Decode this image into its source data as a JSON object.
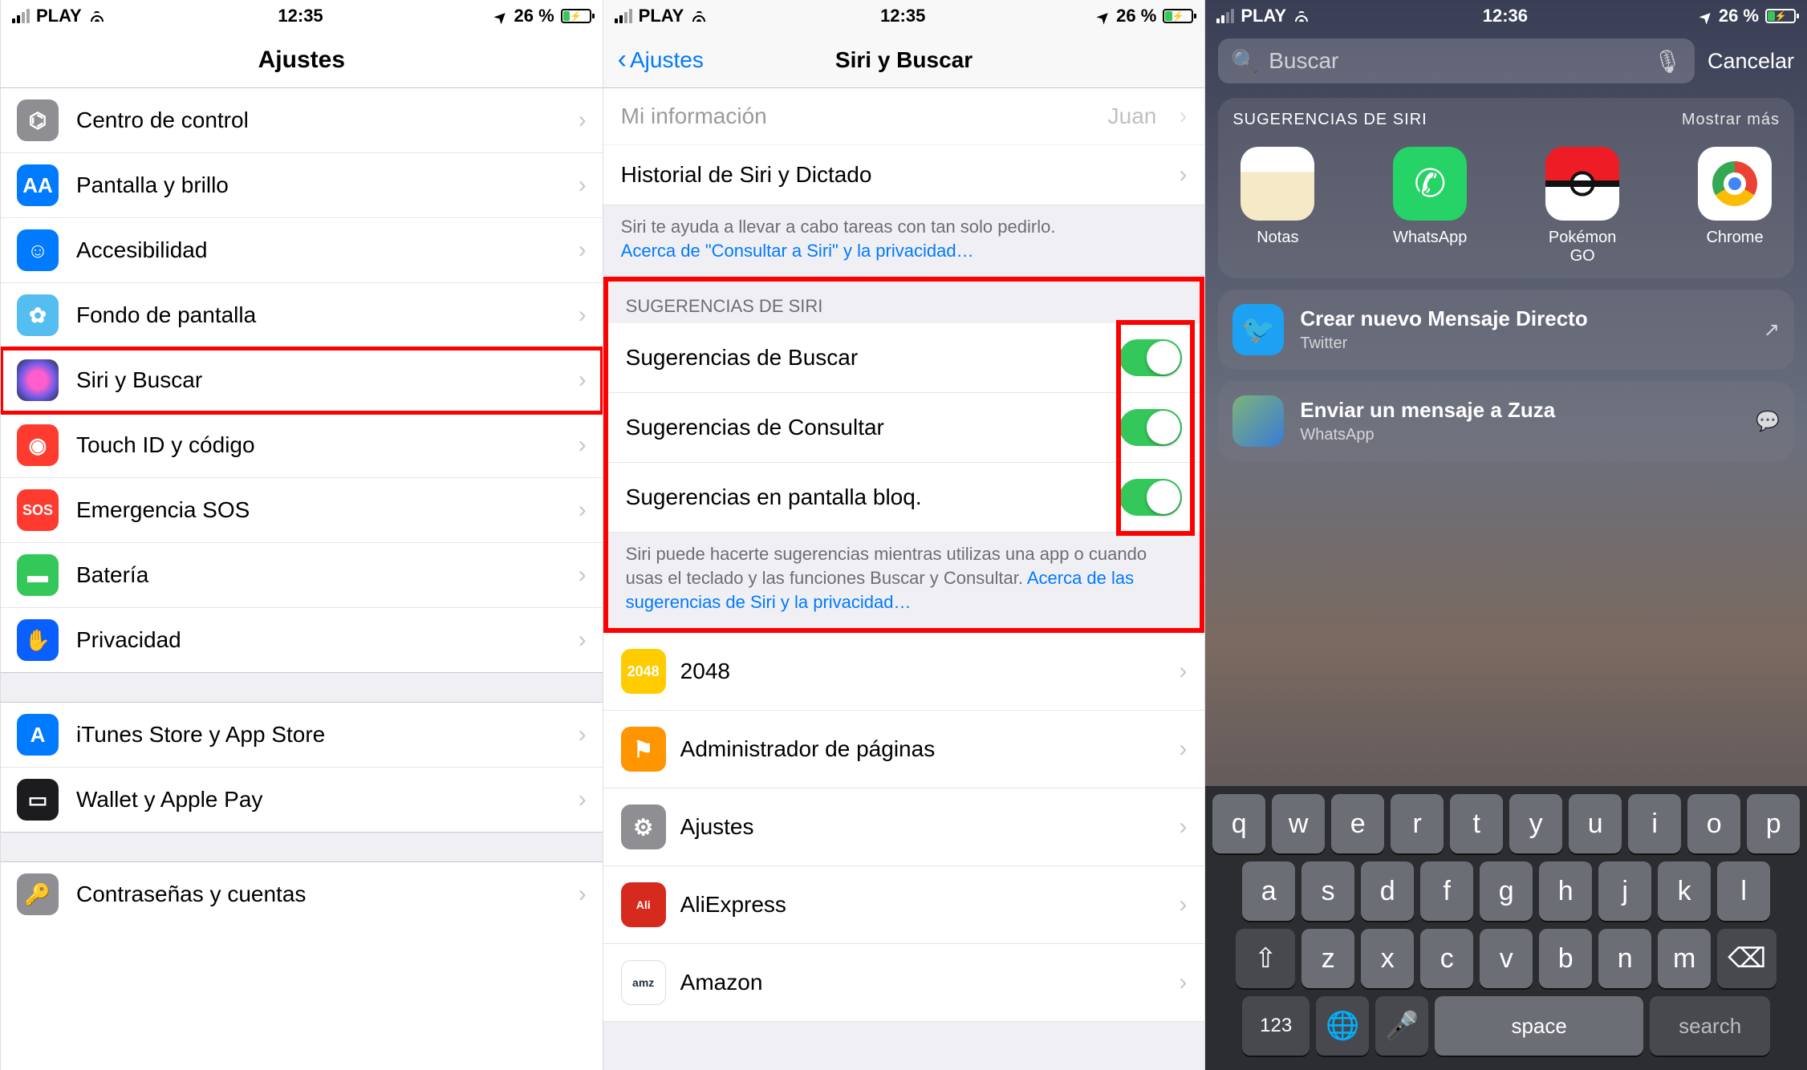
{
  "status": {
    "carrier": "PLAY",
    "time1": "12:35",
    "time2": "12:35",
    "time3": "12:36",
    "battery": "26 %"
  },
  "s1": {
    "title": "Ajustes",
    "rows": [
      {
        "label": "Centro de control"
      },
      {
        "label": "Pantalla y brillo"
      },
      {
        "label": "Accesibilidad"
      },
      {
        "label": "Fondo de pantalla"
      },
      {
        "label": "Siri y Buscar",
        "hl": true
      },
      {
        "label": "Touch ID y código"
      },
      {
        "label": "Emergencia SOS"
      },
      {
        "label": "Batería"
      },
      {
        "label": "Privacidad"
      }
    ],
    "rows2": [
      {
        "label": "iTunes Store y App Store"
      },
      {
        "label": "Wallet y Apple Pay"
      }
    ],
    "rows3": [
      {
        "label": "Contraseñas y cuentas"
      }
    ]
  },
  "s2": {
    "back": "Ajustes",
    "title": "Siri y Buscar",
    "partial": {
      "label": "Mi información",
      "value": "Juan"
    },
    "history": "Historial de Siri y Dictado",
    "foot1_text": "Siri te ayuda a llevar a cabo tareas con tan solo pedirlo.",
    "foot1_link": "Acerca de \"Consultar a Siri\" y la privacidad…",
    "sect": "SUGERENCIAS DE SIRI",
    "toggles": [
      {
        "label": "Sugerencias de Buscar"
      },
      {
        "label": "Sugerencias de Consultar"
      },
      {
        "label": "Sugerencias en pantalla bloq."
      }
    ],
    "foot2_text": "Siri puede hacerte sugerencias mientras utilizas una app o cuando usas el teclado y las funciones Buscar y Consultar.",
    "foot2_link": "Acerca de las sugerencias de Siri y la privacidad…",
    "apps": [
      {
        "label": "2048"
      },
      {
        "label": "Administrador de páginas"
      },
      {
        "label": "Ajustes"
      },
      {
        "label": "AliExpress"
      },
      {
        "label": "Amazon"
      }
    ]
  },
  "s3": {
    "search_placeholder": "Buscar",
    "cancel": "Cancelar",
    "sect": "SUGERENCIAS DE SIRI",
    "more": "Mostrar más",
    "apps": [
      {
        "label": "Notas"
      },
      {
        "label": "WhatsApp"
      },
      {
        "label": "Pokémon GO"
      },
      {
        "label": "Chrome"
      }
    ],
    "actions": [
      {
        "title": "Crear nuevo Mensaje Directo",
        "sub": "Twitter",
        "trail": "↗"
      },
      {
        "title": "Enviar un mensaje a Zuza",
        "sub": "WhatsApp",
        "trail": "💬"
      }
    ],
    "kb": {
      "r1": [
        "q",
        "w",
        "e",
        "r",
        "t",
        "y",
        "u",
        "i",
        "o",
        "p"
      ],
      "r2": [
        "a",
        "s",
        "d",
        "f",
        "g",
        "h",
        "j",
        "k",
        "l"
      ],
      "r3": [
        "z",
        "x",
        "c",
        "v",
        "b",
        "n",
        "m"
      ],
      "shift": "⇧",
      "back": "⌫",
      "num": "123",
      "globe": "🌐",
      "mic": "🎤",
      "space": "space",
      "search": "search"
    }
  }
}
